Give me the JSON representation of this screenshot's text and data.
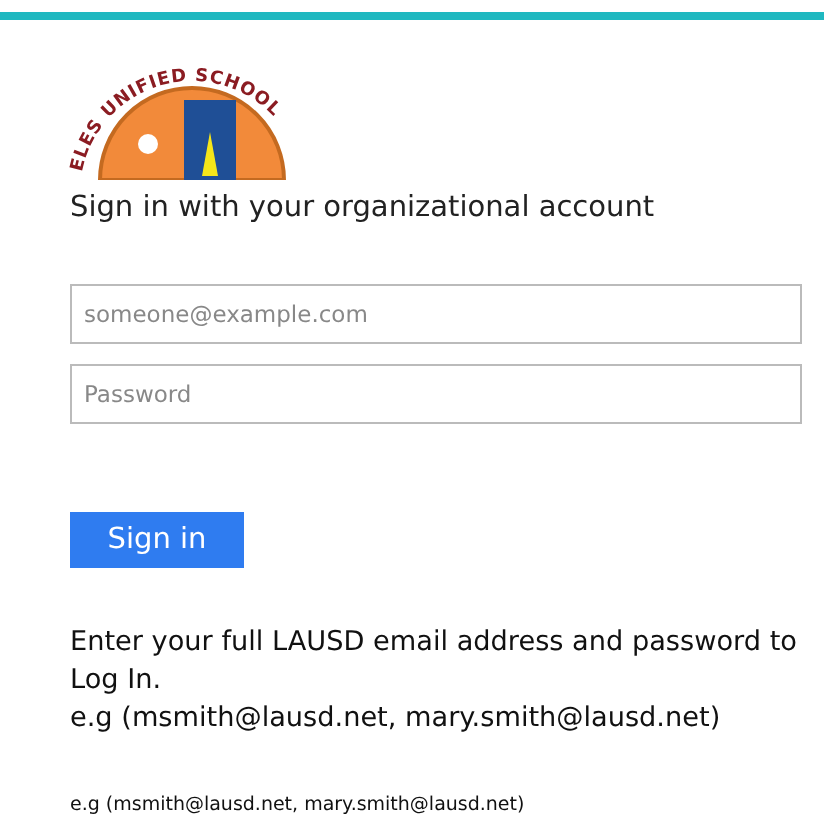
{
  "logo": {
    "text": "ELES UNIFIED SCHOOL"
  },
  "heading": "Sign in with your organizational account",
  "fields": [
    {
      "placeholder": "someone@example.com"
    },
    {
      "placeholder": "Password"
    }
  ],
  "submit_button": "Sign in",
  "help": [
    "Enter your full LAUSD email address and password to Log In.",
    "e.g (msmith@lausd.net, mary.smith@lausd.net)"
  ],
  "footer_note": "e.g (msmith@lausd.net, mary.smith@lausd.net)"
}
